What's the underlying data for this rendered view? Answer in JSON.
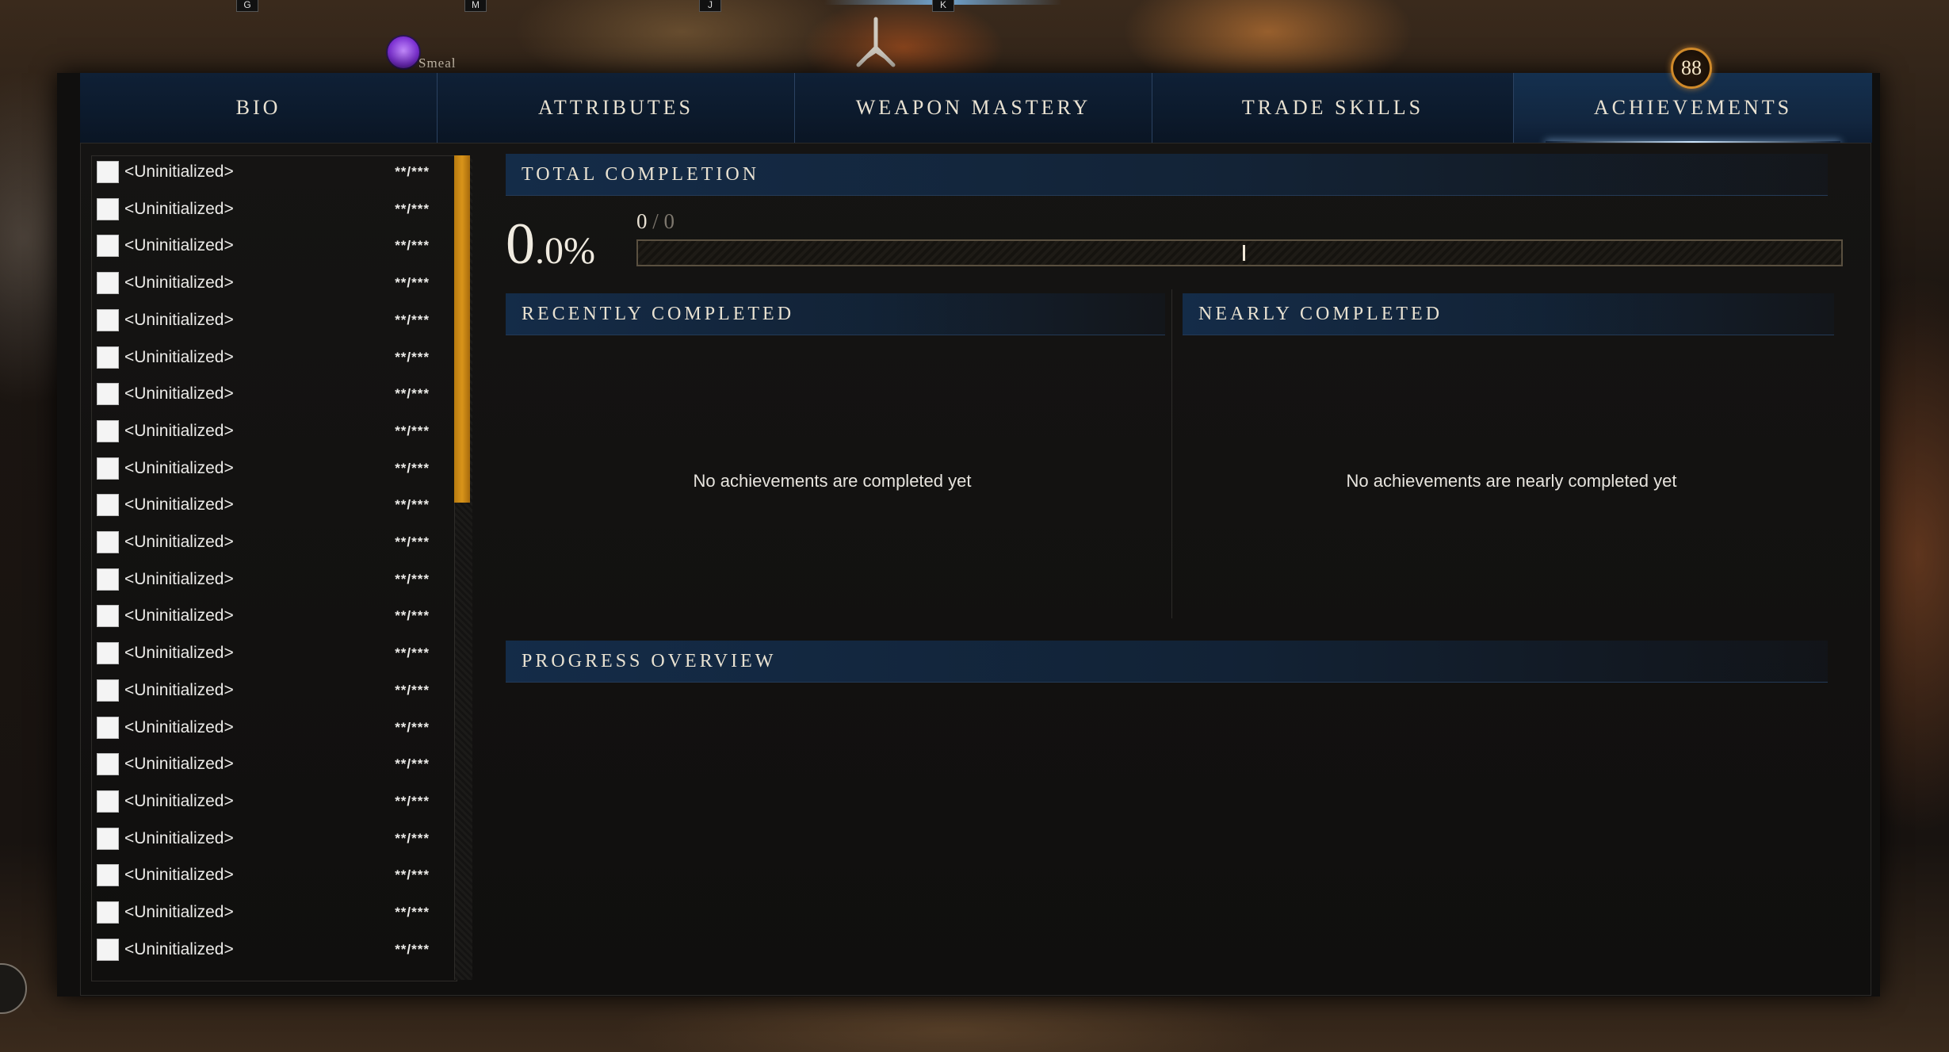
{
  "hotkeys": [
    "G",
    "M",
    "J",
    "K"
  ],
  "player": {
    "name": "Smeal"
  },
  "tabs": [
    {
      "label": "BIO",
      "active": false
    },
    {
      "label": "ATTRIBUTES",
      "active": false
    },
    {
      "label": "WEAPON MASTERY",
      "active": false
    },
    {
      "label": "TRADE SKILLS",
      "active": false
    },
    {
      "label": "ACHIEVEMENTS",
      "active": true
    }
  ],
  "level_badge": "88",
  "achievement_list": {
    "items": [
      {
        "name": "<Uninitialized>",
        "value": "**/***"
      },
      {
        "name": "<Uninitialized>",
        "value": "**/***"
      },
      {
        "name": "<Uninitialized>",
        "value": "**/***"
      },
      {
        "name": "<Uninitialized>",
        "value": "**/***"
      },
      {
        "name": "<Uninitialized>",
        "value": "**/***"
      },
      {
        "name": "<Uninitialized>",
        "value": "**/***"
      },
      {
        "name": "<Uninitialized>",
        "value": "**/***"
      },
      {
        "name": "<Uninitialized>",
        "value": "**/***"
      },
      {
        "name": "<Uninitialized>",
        "value": "**/***"
      },
      {
        "name": "<Uninitialized>",
        "value": "**/***"
      },
      {
        "name": "<Uninitialized>",
        "value": "**/***"
      },
      {
        "name": "<Uninitialized>",
        "value": "**/***"
      },
      {
        "name": "<Uninitialized>",
        "value": "**/***"
      },
      {
        "name": "<Uninitialized>",
        "value": "**/***"
      },
      {
        "name": "<Uninitialized>",
        "value": "**/***"
      },
      {
        "name": "<Uninitialized>",
        "value": "**/***"
      },
      {
        "name": "<Uninitialized>",
        "value": "**/***"
      },
      {
        "name": "<Uninitialized>",
        "value": "**/***"
      },
      {
        "name": "<Uninitialized>",
        "value": "**/***"
      },
      {
        "name": "<Uninitialized>",
        "value": "**/***"
      },
      {
        "name": "<Uninitialized>",
        "value": "**/***"
      },
      {
        "name": "<Uninitialized>",
        "value": "**/***"
      }
    ]
  },
  "total_completion": {
    "title": "TOTAL COMPLETION",
    "percent_int": "0",
    "percent_dec": ".0%",
    "completed": "0",
    "separator": " / ",
    "total": "0",
    "progress_fraction": 0.0
  },
  "recently_completed": {
    "title": "RECENTLY COMPLETED",
    "empty_text": "No achievements are completed yet"
  },
  "nearly_completed": {
    "title": "NEARLY COMPLETED",
    "empty_text": "No achievements are nearly completed yet"
  },
  "progress_overview": {
    "title": "PROGRESS OVERVIEW"
  },
  "colors": {
    "tab_bg": "#0f2036",
    "scroll_thumb": "#d9941a",
    "badge_ring": "#d08a2a",
    "text": "#e9e2d2"
  }
}
